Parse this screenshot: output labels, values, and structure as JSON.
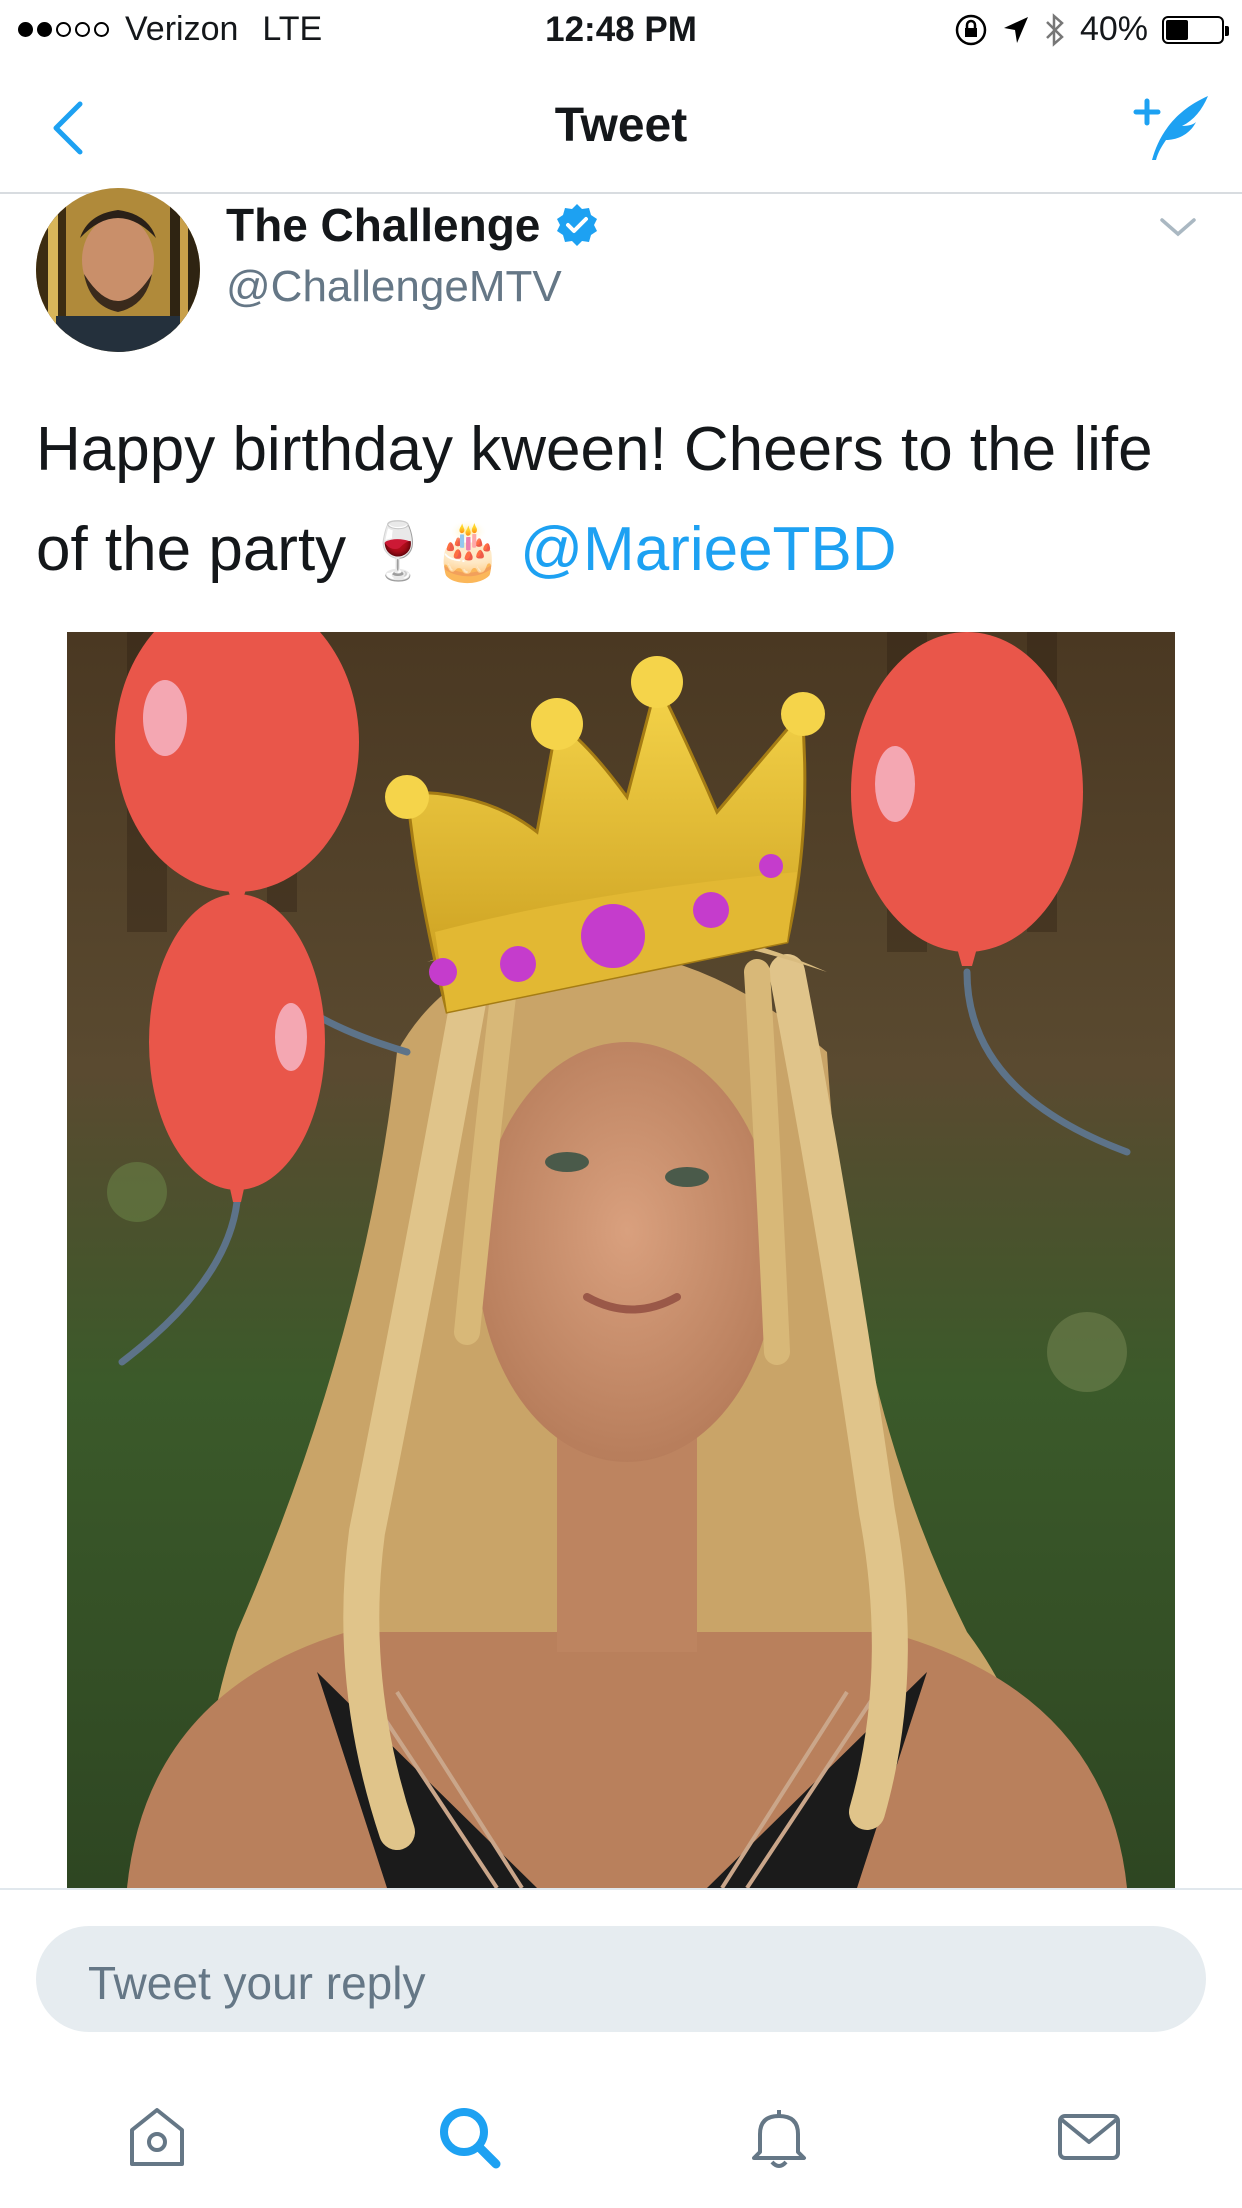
{
  "status_bar": {
    "carrier": "Verizon",
    "network": "LTE",
    "time": "12:48 PM",
    "battery_percent": "40%",
    "battery_level": 0.4,
    "signal_bars": 2
  },
  "nav": {
    "title": "Tweet",
    "back_icon": "chevron-left-icon",
    "compose_icon": "compose-tweet-icon"
  },
  "tweet": {
    "author_name": "The Challenge",
    "verified": true,
    "handle": "@ChallengeMTV",
    "text_part1": "Happy birthday kween! Cheers to the life of the party",
    "emoji": "🍷🎂",
    "mention": "@MarieeTBD"
  },
  "reply": {
    "placeholder": "Tweet your reply"
  },
  "tabs": [
    {
      "name": "home",
      "icon": "home-icon",
      "active": false
    },
    {
      "name": "search",
      "icon": "search-icon",
      "active": true
    },
    {
      "name": "notifications",
      "icon": "bell-icon",
      "active": false
    },
    {
      "name": "messages",
      "icon": "mail-icon",
      "active": false
    }
  ],
  "colors": {
    "accent": "#1da1f2",
    "text_secondary": "#657786",
    "divider": "#d8dce0"
  }
}
